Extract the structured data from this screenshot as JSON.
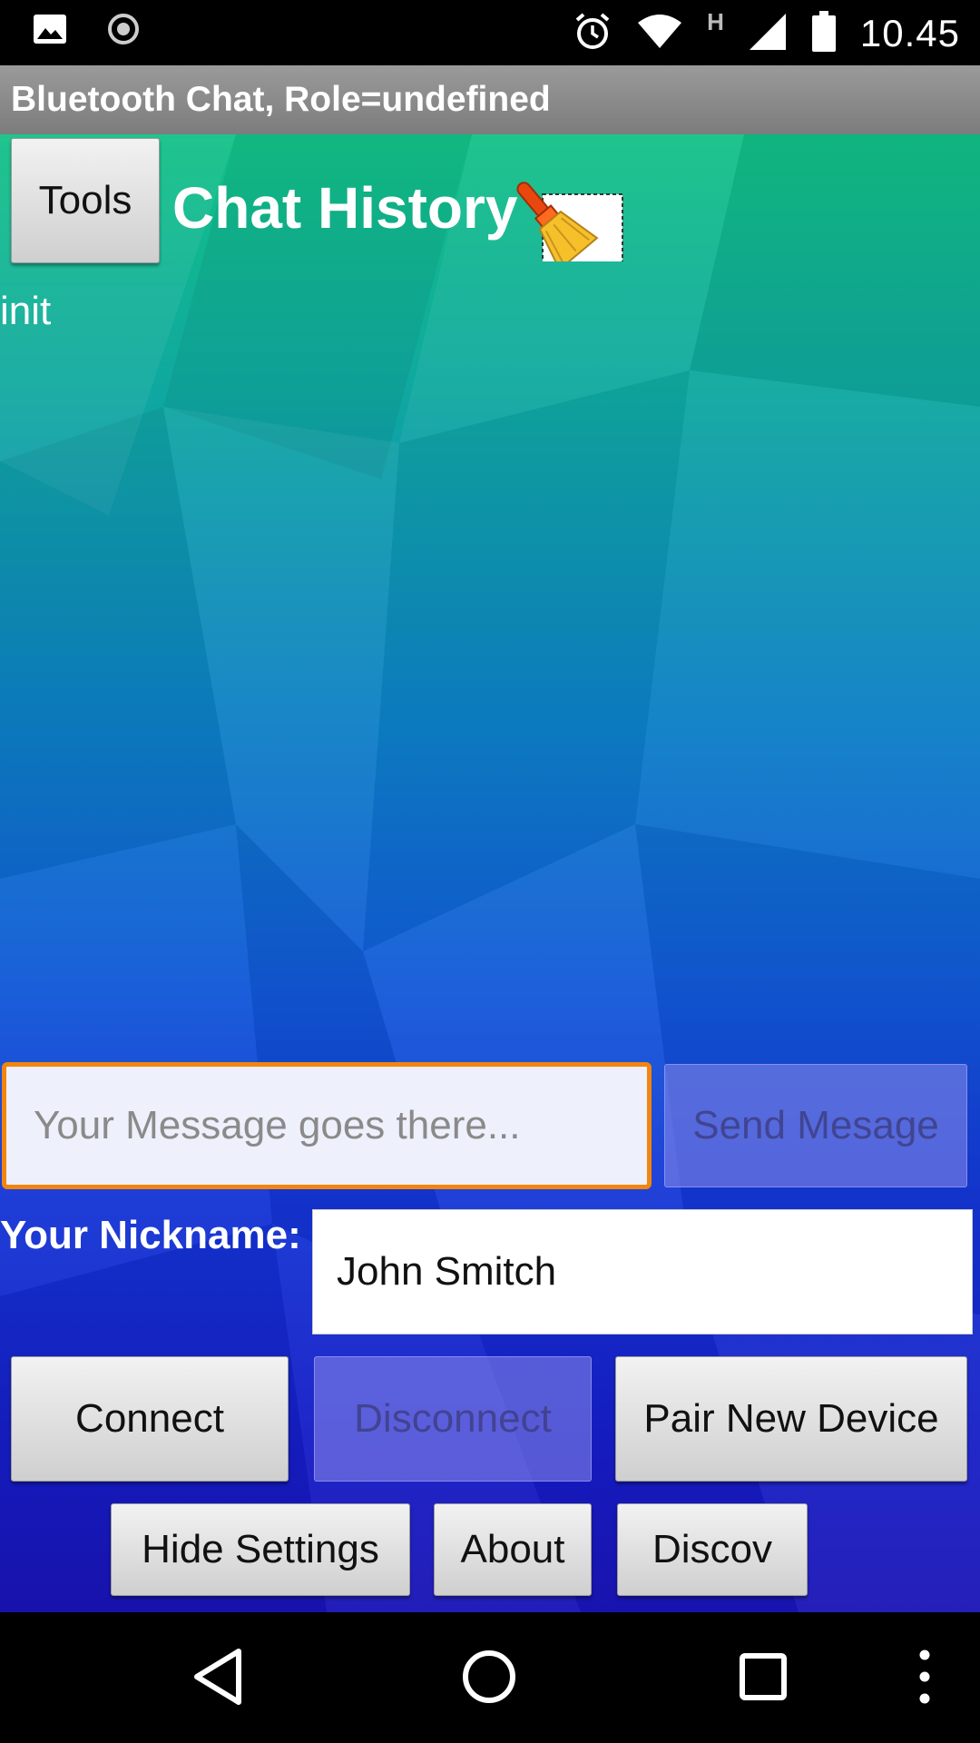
{
  "status_bar": {
    "time": "10.45",
    "network_type": "H",
    "icons": [
      "image-icon",
      "sync-icon",
      "alarm-icon",
      "wifi-icon",
      "signal-icon",
      "battery-icon"
    ]
  },
  "app": {
    "title": "Bluetooth Chat, Role=undefined"
  },
  "header": {
    "tools_label": "Tools",
    "chat_title": "Chat History",
    "clear_icon": "broom-icon"
  },
  "chat": {
    "log_text": "init"
  },
  "message": {
    "placeholder": "Your Message goes there...",
    "value": "",
    "send_label": "Send Mesage",
    "send_enabled": false
  },
  "nickname": {
    "label": "Your Nickname:",
    "value": "John Smitch"
  },
  "actions": {
    "connect_label": "Connect",
    "disconnect_label": "Disconnect",
    "disconnect_enabled": false,
    "pair_label": "Pair New Device",
    "hide_settings_label": "Hide Settings",
    "about_label": "About",
    "discover_label": "Discov"
  },
  "nav_bar": {
    "icons": [
      "back-icon",
      "home-icon",
      "recents-icon",
      "overflow-menu-icon"
    ]
  },
  "colors": {
    "accent_focus": "#f2850e",
    "background_top": "#12c186",
    "background_bottom": "#1a14b6",
    "title_bar": "#8a8a8a"
  }
}
